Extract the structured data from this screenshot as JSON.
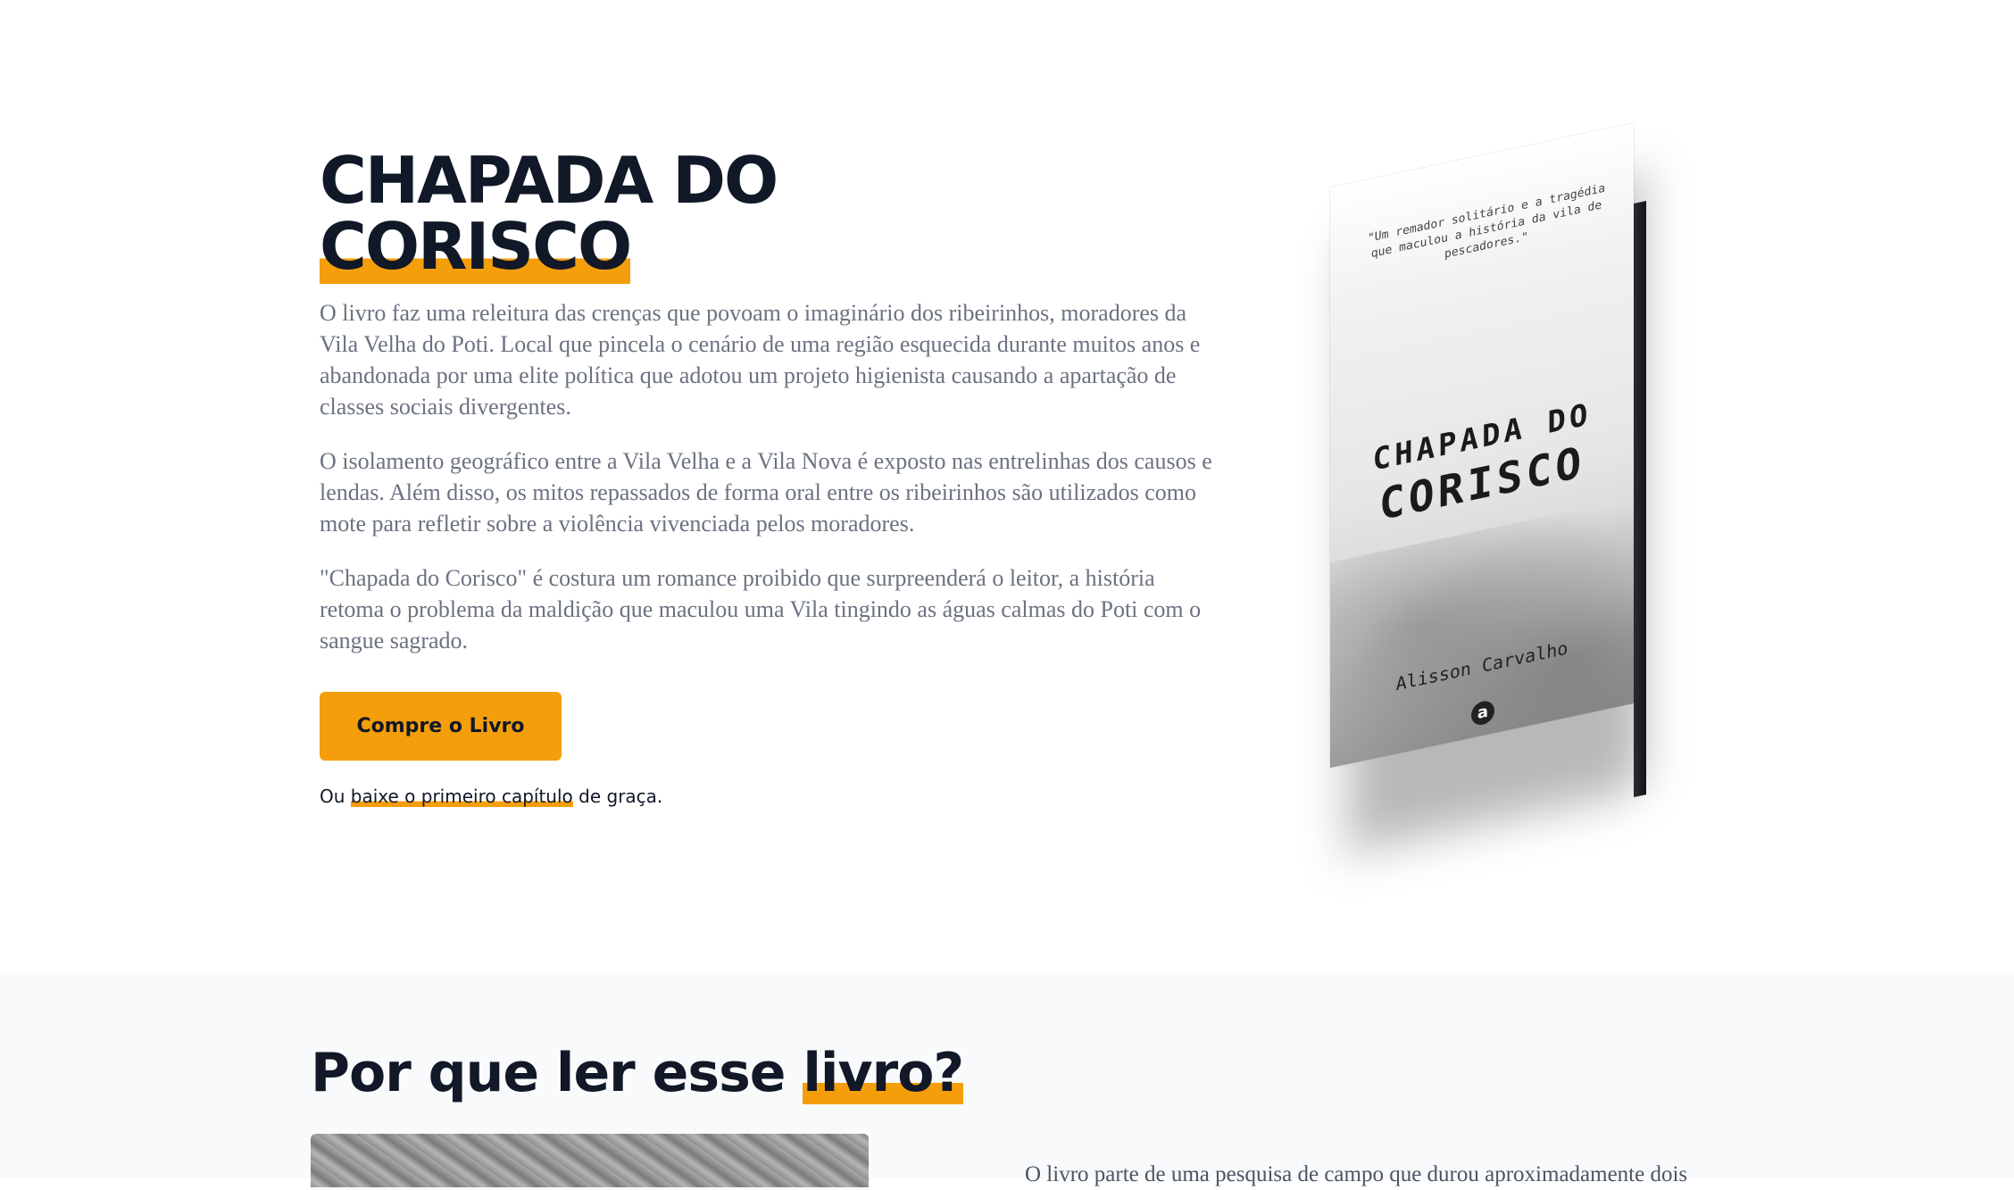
{
  "hero": {
    "title_line1": "CHAPADA DO",
    "title_line2": "CORISCO",
    "paragraphs": [
      "O livro faz uma releitura das crenças que povoam o imaginário dos ribeirinhos, moradores da Vila Velha do Poti. Local que pincela o cenário de uma região esquecida durante muitos anos e abandonada por uma elite política que adotou um projeto higienista causando a apartação de classes sociais divergentes.",
      "O isolamento geográfico entre a Vila Velha e a Vila Nova é exposto nas entrelinhas dos causos e lendas. Além disso, os mitos repassados de forma oral entre os ribeirinhos são utilizados como mote para refletir sobre a violência vivenciada pelos moradores.",
      "\"Chapada do Corisco\" é costura um romance proibido que surpreenderá o leitor, a história retoma o problema da maldição que maculou uma Vila tingindo as águas calmas do Poti com o sangue sagrado."
    ],
    "buy_label": "Compre o Livro",
    "free_prefix": "Ou ",
    "free_link": "baixe o primeiro capítulo",
    "free_suffix": " de graça."
  },
  "book_cover": {
    "quote": "\"Um remador solitário e a tragédia que maculou a história da vila de pescadores.\"",
    "title_line1": "CHAPADA DO",
    "title_line2": "CORISCO",
    "author": "Alisson Carvalho",
    "publisher_mark": "a"
  },
  "why": {
    "title_prefix": "Por que ler esse ",
    "title_highlight": "livro?",
    "text": "O livro parte de uma pesquisa de campo que durou aproximadamente dois"
  },
  "colors": {
    "accent": "#f59e0b",
    "heading": "#111827",
    "body_text": "#6b7280",
    "section_bg": "#f9fafb"
  }
}
